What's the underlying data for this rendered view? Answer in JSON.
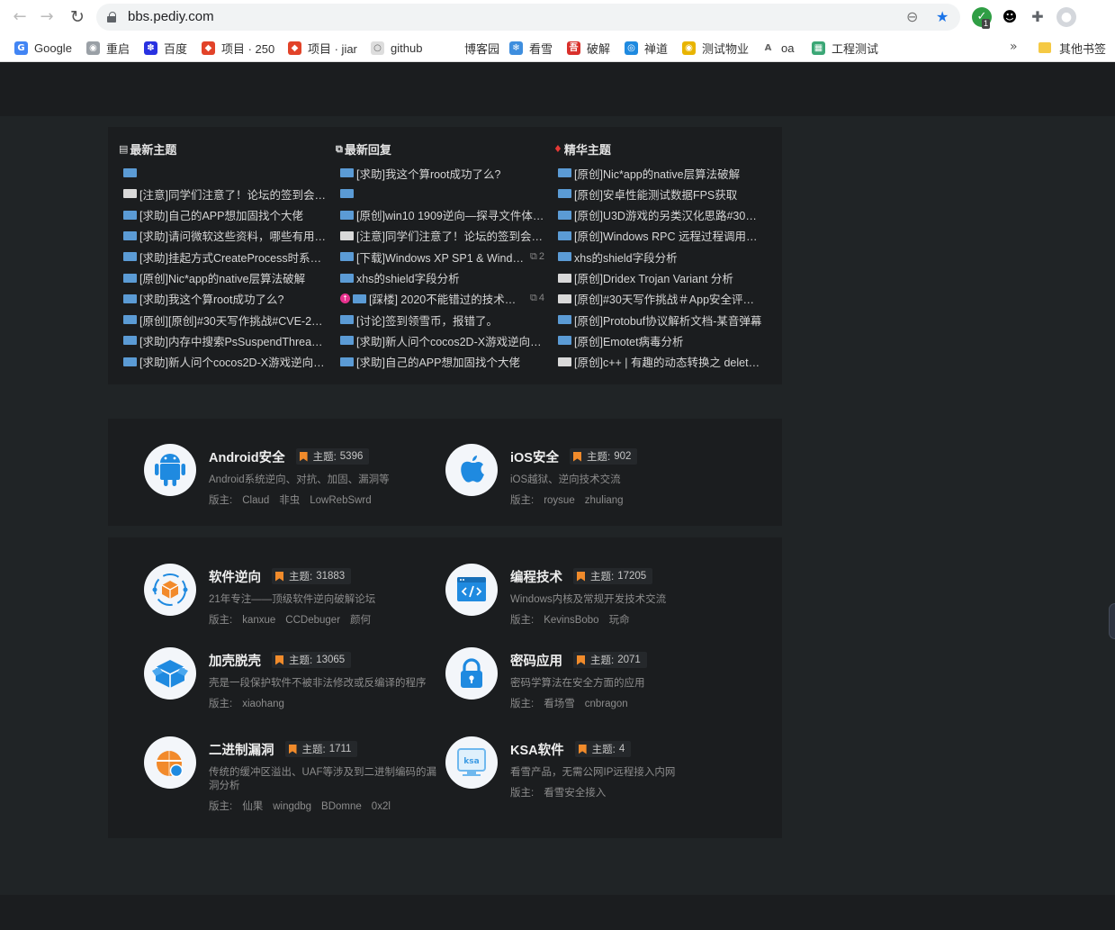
{
  "browser": {
    "url": "bbs.pediy.com",
    "extension_badge": "1",
    "bookmarks": [
      {
        "label": "Google",
        "color": "#4285f4",
        "glyph": "G"
      },
      {
        "label": "重启",
        "color": "#9aa0a6",
        "glyph": "◉"
      },
      {
        "label": "百度",
        "color": "#2932e1",
        "glyph": "✽"
      },
      {
        "label": "项目 · 250",
        "color": "#e24329",
        "glyph": "◆"
      },
      {
        "label": "项目 · jiar",
        "color": "#e24329",
        "glyph": "◆"
      },
      {
        "label": "github",
        "color": "#dddddd",
        "glyph": "○"
      },
      {
        "label": "博客园",
        "color": "#ffffff",
        "glyph": ""
      },
      {
        "label": "看雪",
        "color": "#3e8ede",
        "glyph": "❄"
      },
      {
        "label": "破解",
        "color": "#d9302b",
        "glyph": "吾"
      },
      {
        "label": "禅道",
        "color": "#1f8ae0",
        "glyph": "◎"
      },
      {
        "label": "测试物业",
        "color": "#e8b400",
        "glyph": "◉"
      },
      {
        "label": "oa",
        "color": "#ffffff",
        "glyph": "A"
      },
      {
        "label": "工程测试",
        "color": "#3ba776",
        "glyph": "▦"
      }
    ],
    "other_bookmarks": "其他书签"
  },
  "latest": {
    "columns": [
      {
        "title": "最新主题",
        "icon": "doc-icon",
        "threads": [
          {
            "text": "",
            "read": false,
            "replies": ""
          },
          {
            "text": "[注意]同学们注意了！论坛的签到会跳…",
            "read": true,
            "replies": ""
          },
          {
            "text": "[求助]自己的APP想加固找个大佬",
            "read": false,
            "replies": ""
          },
          {
            "text": "[求助]请问微软这些资料，哪些有用，…",
            "read": false,
            "replies": ""
          },
          {
            "text": "[求助]挂起方式CreateProcess时系统…",
            "read": false,
            "replies": ""
          },
          {
            "text": "[原创]Nic*app的native层算法破解",
            "read": false,
            "replies": ""
          },
          {
            "text": "[求助]我这个算root成功了么?",
            "read": false,
            "replies": ""
          },
          {
            "text": "[原创][原创]#30天写作挑战#CVE-202…",
            "read": false,
            "replies": ""
          },
          {
            "text": "[求助]内存中搜索PsSuspendThread…",
            "read": false,
            "replies": ""
          },
          {
            "text": "[求助]新人问个cocos2D-X游戏逆向问题",
            "read": false,
            "replies": ""
          }
        ]
      },
      {
        "title": "最新回复",
        "icon": "reply-icon",
        "threads": [
          {
            "text": "[求助]我这个算root成功了么?",
            "read": false,
            "replies": ""
          },
          {
            "text": "",
            "read": false,
            "replies": ""
          },
          {
            "text": "[原创]win10 1909逆向—探寻文件体系1",
            "read": false,
            "replies": ""
          },
          {
            "text": "[注意]同学们注意了！论坛的签到会跳…",
            "read": true,
            "replies": ""
          },
          {
            "text": "[下载]Windows XP SP1 & Windo…",
            "read": false,
            "replies": "2"
          },
          {
            "text": "xhs的shield字段分析",
            "read": false,
            "replies": ""
          },
          {
            "text": "[踩楼] 2020不能错过的技术大…",
            "read": false,
            "replies": "4",
            "pinned": true
          },
          {
            "text": "[讨论]签到领雪币，报错了。",
            "read": false,
            "replies": ""
          },
          {
            "text": "[求助]新人问个cocos2D-X游戏逆向问题",
            "read": false,
            "replies": ""
          },
          {
            "text": "[求助]自己的APP想加固找个大佬",
            "read": false,
            "replies": ""
          }
        ]
      },
      {
        "title": "精华主题",
        "icon": "diamond-icon",
        "threads": [
          {
            "text": "[原创]Nic*app的native层算法破解",
            "read": false,
            "replies": ""
          },
          {
            "text": "[原创]安卓性能测试数据FPS获取",
            "read": false,
            "replies": ""
          },
          {
            "text": "[原创]U3D游戏的另类汉化思路#30天写…",
            "read": false,
            "replies": ""
          },
          {
            "text": "[原创]Windows RPC 远程过程调用—初…",
            "read": false,
            "replies": ""
          },
          {
            "text": "xhs的shield字段分析",
            "read": false,
            "replies": ""
          },
          {
            "text": "[原创]Dridex Trojan Variant 分析",
            "read": true,
            "replies": ""
          },
          {
            "text": "[原创]#30天写作挑战＃App安全评估手…",
            "read": true,
            "replies": ""
          },
          {
            "text": "[原创]Protobuf协议解析文档-某音弹幕",
            "read": false,
            "replies": ""
          },
          {
            "text": "[原创]Emotet病毒分析",
            "read": false,
            "replies": ""
          },
          {
            "text": "[原创]c++ | 有趣的动态转换之 delete 崩…",
            "read": true,
            "replies": ""
          }
        ]
      }
    ]
  },
  "forums": {
    "topic_label": "主题:",
    "mod_label": "版主:",
    "mobile": [
      {
        "name": "Android安全",
        "icon": "android-icon",
        "count": "5396",
        "desc": "Android系统逆向、对抗、加固、漏洞等",
        "mods": [
          "Claud",
          "非虫",
          "LowRebSwrd"
        ]
      },
      {
        "name": "iOS安全",
        "icon": "apple-icon",
        "count": "902",
        "desc": "iOS越狱、逆向技术交流",
        "mods": [
          "roysue",
          "zhuliang"
        ]
      }
    ],
    "pc": [
      {
        "name": "软件逆向",
        "icon": "reverse-icon",
        "count": "31883",
        "desc": "21年专注——顶级软件逆向破解论坛",
        "mods": [
          "kanxue",
          "CCDebuger",
          "颜何"
        ]
      },
      {
        "name": "编程技术",
        "icon": "code-icon",
        "count": "17205",
        "desc": "Windows内核及常规开发技术交流",
        "mods": [
          "KevinsBobo",
          "玩命"
        ]
      },
      {
        "name": "加壳脱壳",
        "icon": "box-icon",
        "count": "13065",
        "desc": "壳是一段保护软件不被非法修改或反编译的程序",
        "mods": [
          "xiaohang"
        ]
      },
      {
        "name": "密码应用",
        "icon": "lock-icon",
        "count": "2071",
        "desc": "密码学算法在安全方面的应用",
        "mods": [
          "看场雪",
          "cnbragon"
        ]
      },
      {
        "name": "二进制漏洞",
        "icon": "bug-icon",
        "count": "1711",
        "desc": "传统的缓冲区溢出、UAF等涉及到二进制编码的漏洞分析",
        "mods": [
          "仙果",
          "wingdbg",
          "BDomne",
          "0x2l"
        ]
      },
      {
        "name": "KSA软件",
        "icon": "ksa-icon",
        "count": "4",
        "desc": "看雪产品，无需公网IP远程接入内网",
        "mods": [
          "看雪安全接入"
        ]
      }
    ]
  }
}
